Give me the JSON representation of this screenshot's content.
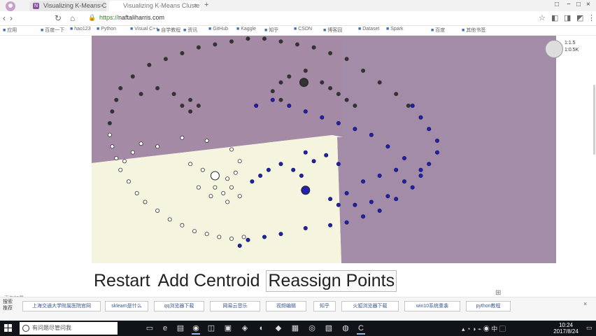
{
  "browser": {
    "tabs": [
      {
        "favicon": "N",
        "title": "Visualizing K-Means Clusterin"
      },
      {
        "favicon": "",
        "title": "Visualizing K-Means Clustering"
      }
    ],
    "address": {
      "protocol": "https://",
      "host": "naftaliharris.com"
    },
    "bookmarks": [
      "应用",
      "百度一下",
      "hao123",
      "Python",
      "Visual C++",
      "自学教程",
      "资讯",
      "GitHub",
      "Kaggle",
      "知乎",
      "CSDN",
      "博客园",
      "Dataset",
      "Spark",
      "百度",
      "其他书签"
    ]
  },
  "page": {
    "controls": {
      "restart": "Restart",
      "add_centroid": "Add Centroid",
      "reassign": "Reassign Points"
    },
    "status_left": "正在加载..."
  },
  "chart_data": {
    "type": "scatter",
    "title": "",
    "xlabel": "",
    "ylabel": "",
    "grid": false,
    "legend": "none",
    "series": [
      {
        "color": "#2222aa",
        "style": "filled-dark-blue",
        "points": [
          [
            690,
            300
          ],
          [
            700,
            320
          ],
          [
            710,
            340
          ],
          [
            720,
            360
          ],
          [
            720,
            380
          ],
          [
            710,
            400
          ],
          [
            700,
            420
          ],
          [
            690,
            440
          ],
          [
            670,
            460
          ],
          [
            650,
            480
          ],
          [
            630,
            490
          ],
          [
            610,
            500
          ],
          [
            590,
            505
          ],
          [
            560,
            510
          ],
          [
            530,
            520
          ],
          [
            510,
            525
          ],
          [
            490,
            530
          ],
          [
            480,
            540
          ],
          [
            500,
            300
          ],
          [
            520,
            290
          ],
          [
            540,
            300
          ],
          [
            560,
            310
          ],
          [
            580,
            320
          ],
          [
            600,
            330
          ],
          [
            620,
            340
          ],
          [
            640,
            350
          ],
          [
            660,
            370
          ],
          [
            680,
            390
          ],
          [
            700,
            410
          ],
          [
            650,
            420
          ],
          [
            630,
            430
          ],
          [
            610,
            450
          ],
          [
            590,
            460
          ],
          [
            600,
            470
          ],
          [
            620,
            470
          ],
          [
            640,
            465
          ],
          [
            660,
            455
          ],
          [
            680,
            430
          ],
          [
            670,
            410
          ],
          [
            560,
            380
          ],
          [
            570,
            395
          ],
          [
            585,
            385
          ],
          [
            600,
            400
          ],
          [
            530,
            400
          ],
          [
            545,
            410
          ],
          [
            555,
            420
          ],
          [
            515,
            410
          ],
          [
            505,
            420
          ],
          [
            495,
            430
          ]
        ]
      },
      {
        "color": "#333333",
        "style": "dark-hollow",
        "points": [
          [
            370,
            230
          ],
          [
            390,
            220
          ],
          [
            410,
            210
          ],
          [
            430,
            200
          ],
          [
            450,
            195
          ],
          [
            470,
            190
          ],
          [
            490,
            185
          ],
          [
            510,
            185
          ],
          [
            530,
            190
          ],
          [
            550,
            195
          ],
          [
            570,
            200
          ],
          [
            590,
            210
          ],
          [
            610,
            220
          ],
          [
            630,
            240
          ],
          [
            650,
            260
          ],
          [
            670,
            280
          ],
          [
            685,
            300
          ],
          [
            350,
            250
          ],
          [
            335,
            270
          ],
          [
            330,
            290
          ],
          [
            325,
            310
          ],
          [
            322,
            330
          ],
          [
            360,
            280
          ],
          [
            380,
            270
          ],
          [
            400,
            280
          ],
          [
            420,
            290
          ],
          [
            410,
            300
          ],
          [
            420,
            310
          ],
          [
            430,
            300
          ],
          [
            580,
            260
          ],
          [
            590,
            270
          ],
          [
            600,
            280
          ],
          [
            610,
            290
          ],
          [
            620,
            300
          ],
          [
            560,
            240
          ],
          [
            540,
            250
          ],
          [
            530,
            260
          ],
          [
            520,
            275
          ],
          [
            530,
            290
          ]
        ]
      },
      {
        "color": "#ffffff",
        "style": "light-hollow",
        "points": [
          [
            322,
            350
          ],
          [
            325,
            370
          ],
          [
            330,
            390
          ],
          [
            335,
            410
          ],
          [
            345,
            430
          ],
          [
            355,
            450
          ],
          [
            365,
            465
          ],
          [
            380,
            480
          ],
          [
            395,
            495
          ],
          [
            410,
            505
          ],
          [
            425,
            515
          ],
          [
            440,
            520
          ],
          [
            455,
            525
          ],
          [
            470,
            528
          ],
          [
            485,
            525
          ],
          [
            420,
            400
          ],
          [
            435,
            410
          ],
          [
            450,
            420
          ],
          [
            465,
            425
          ],
          [
            475,
            415
          ],
          [
            450,
            440
          ],
          [
            430,
            440
          ],
          [
            445,
            455
          ],
          [
            460,
            450
          ],
          [
            470,
            440
          ],
          [
            480,
            455
          ],
          [
            465,
            465
          ],
          [
            380,
            370
          ],
          [
            360,
            365
          ],
          [
            350,
            380
          ],
          [
            340,
            395
          ],
          [
            410,
            355
          ],
          [
            440,
            360
          ],
          [
            470,
            375
          ],
          [
            480,
            395
          ]
        ]
      }
    ],
    "centroids": [
      {
        "color": "#2222aa",
        "x": 560,
        "y": 445
      },
      {
        "color": "#333333",
        "x": 558,
        "y": 260
      },
      {
        "color": "#ffffff",
        "x": 450,
        "y": 420
      }
    ],
    "regions": [
      {
        "color": "#a58aa5",
        "label": ""
      },
      {
        "color": "#a38ca8",
        "label": ""
      },
      {
        "color": "#f5f5df",
        "label": ""
      }
    ]
  },
  "search_strip": {
    "label": "搜索推荐",
    "chips": [
      "上海交通大学附属医院官网",
      "sklearn是什么",
      "qq浏览器下载",
      "网易云音乐",
      "视频编辑",
      "知乎",
      "火狐浏览器下载",
      "win10系统重装",
      "python教程"
    ]
  },
  "widget": {
    "line1": "1:1.5",
    "line2": "1:0.5K"
  },
  "taskbar": {
    "search_placeholder": "有问题尽管问我",
    "clock_time": "10:24",
    "clock_date": "2017/8/24"
  },
  "icons": [
    "avatar-icon",
    "back-icon",
    "forward-icon",
    "reload-icon",
    "lock-icon",
    "star-icon",
    "menu-icon",
    "windows-start-icon",
    "search-ring-icon",
    "grid-icon",
    "close-icon",
    "minimize-icon",
    "maximize-icon"
  ]
}
